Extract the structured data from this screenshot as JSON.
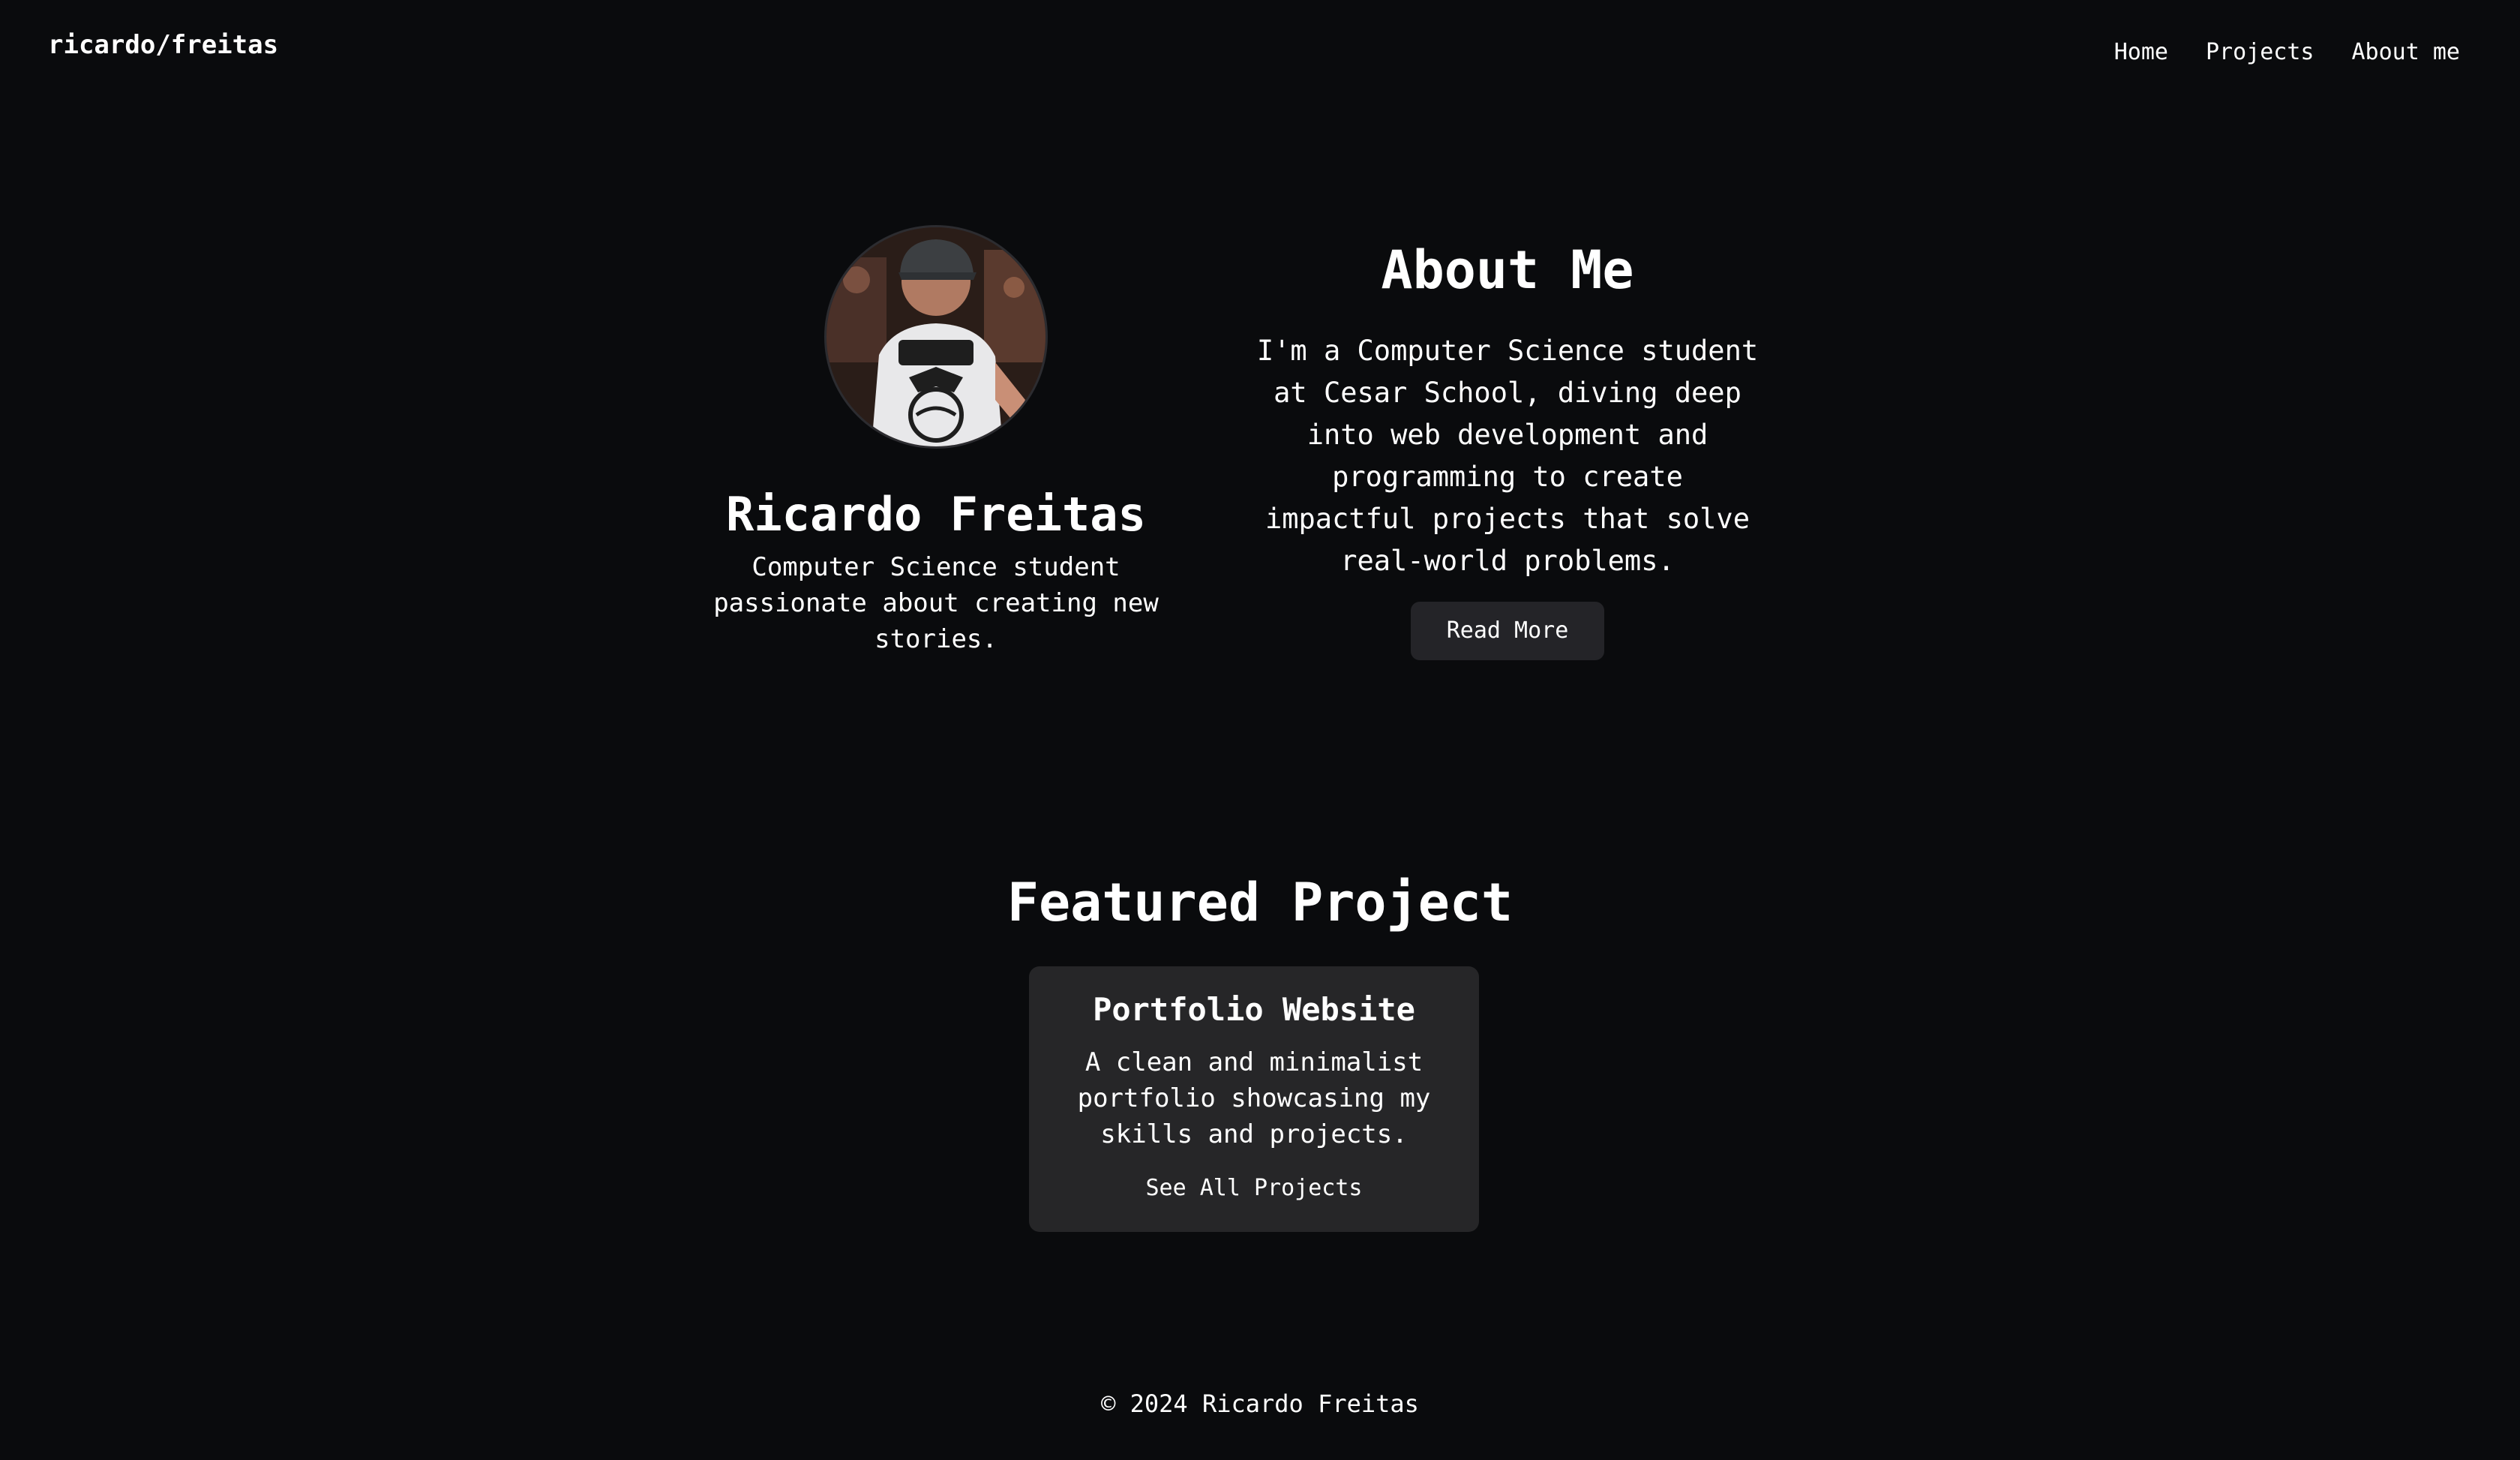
{
  "header": {
    "brand": "ricardo/freitas",
    "nav": [
      "Home",
      "Projects",
      "About me"
    ]
  },
  "profile": {
    "avatar_alt": "profile photo",
    "name": "Ricardo Freitas",
    "tagline": "Computer Science student passionate about creating new stories."
  },
  "about": {
    "title": "About Me",
    "text": "I'm a Computer Science student at Cesar School, diving deep into web development and programming to create impactful projects that solve real-world problems.",
    "button": "Read More"
  },
  "featured": {
    "title": "Featured Project",
    "card": {
      "title": "Portfolio Website",
      "description": "A clean and minimalist portfolio showcasing my skills and projects.",
      "link": "See All Projects"
    }
  },
  "footer": {
    "text": "© 2024 Ricardo Freitas"
  },
  "colors": {
    "background": "#0a0b0d",
    "surface": "#262628",
    "text": "#ffffff"
  }
}
